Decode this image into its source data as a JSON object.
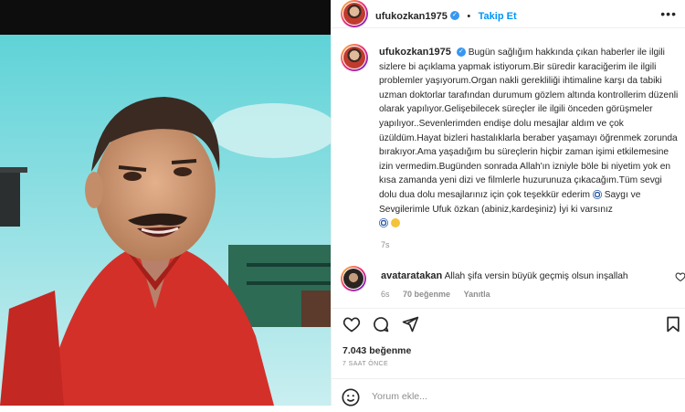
{
  "post": {
    "username": "ufukozkan1975",
    "verified_mark": "✓",
    "follow_label": "Takip Et",
    "separator": "•",
    "more_label": "•••"
  },
  "caption": {
    "username": "ufukozkan1975",
    "text": "Bugün sağlığım hakkında çıkan haberler ile ilgili sizlere bi açıklama yapmak istiyorum.Bir süredir karaciğerim ile ilgili problemler yaşıyorum.Organ nakli gerekliliği ihtimaline karşı da tabiki uzman doktorlar tarafından durumum gözlem altında kontrollerim düzenli olarak yapılıyor.Gelişebilecek süreçler ile ilgili önceden görüşmeler yapılıyor..Sevenlerimden endişe dolu mesajlar aldım ve çok üzüldüm.Hayat bizleri hastalıklarla beraber yaşamayı öğrenmek zorunda bırakıyor.Ama yaşadığım bu süreçlerin hiçbir zaman işimi etkilemesine izin vermedim.Bugünden sonrada Allah'ın izniyle böle bi niyetim yok en kısa zamanda yeni dizi ve filmlerle huzurunuza çıkacağım.Tüm sevgi dolu dua dolu mesajlarınız için çok teşekkür ederim",
    "text_end": "Saygı ve Sevgilerimle Ufuk özkan (abiniz,kardeşiniz) İyi ki varsınız",
    "emoji_icons": [
      "nazar-eye-icon",
      "nazar-eye-icon",
      "hugging-face-icon"
    ],
    "age": "7s"
  },
  "comment": {
    "username": "avataratakan",
    "text": "Allah şifa versin büyük geçmiş olsun inşallah",
    "age": "6s",
    "likes": "70 beğenme",
    "reply_label": "Yanıtla"
  },
  "actions": {
    "icons": [
      "heart-icon",
      "comment-icon",
      "share-icon",
      "save-icon"
    ]
  },
  "stats": {
    "likes": "7.043 beğenme",
    "time": "7 SAAT ÖNCE"
  },
  "add_comment": {
    "placeholder": "Yorum ekle..."
  },
  "colors": {
    "accent": "#0095f6",
    "verified": "#3897f0",
    "muted": "#8e8e8e",
    "text": "#262626"
  }
}
